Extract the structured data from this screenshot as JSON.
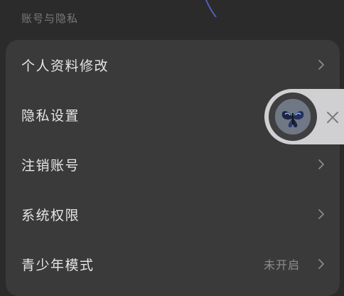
{
  "section_title": "账号与隐私",
  "settings": [
    {
      "label": "个人资料修改",
      "value": ""
    },
    {
      "label": "隐私设置",
      "value": ""
    },
    {
      "label": "注销账号",
      "value": ""
    },
    {
      "label": "系统权限",
      "value": ""
    },
    {
      "label": "青少年模式",
      "value": "未开启"
    }
  ],
  "colors": {
    "background": "#2b2b2c",
    "card": "#3a3a3b",
    "text_primary": "#e6e6e6",
    "text_secondary": "#8d8d8f",
    "floating_widget": "#d0d0d2"
  },
  "icons": {
    "chevron": "chevron-right-icon",
    "close": "close-icon",
    "avatar": "butterfly-avatar"
  }
}
